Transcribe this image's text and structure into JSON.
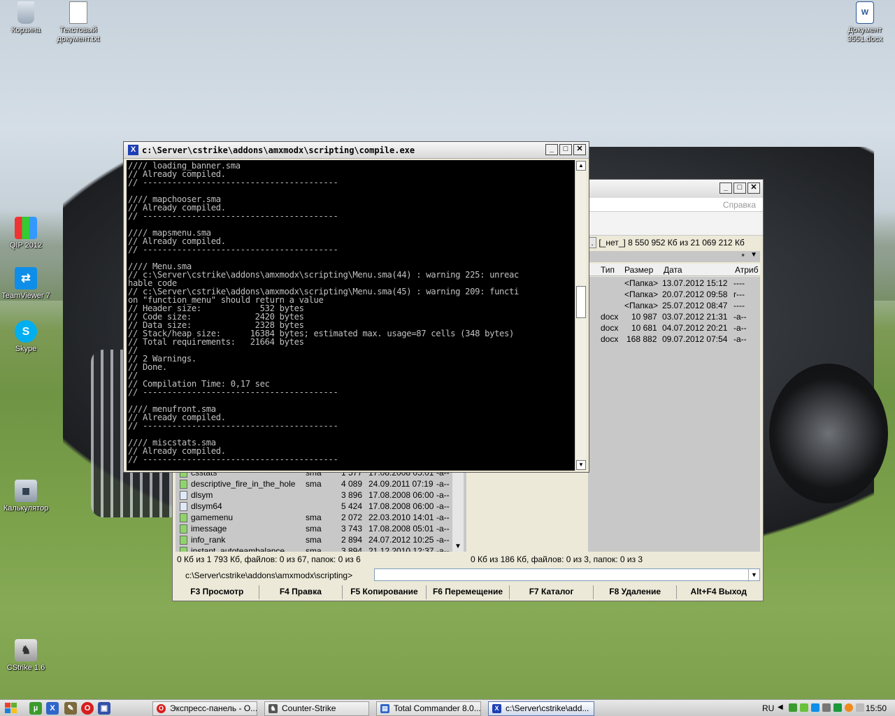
{
  "desktop_icons": [
    {
      "label": "Корзина",
      "icon": "recycle-bin-icon"
    },
    {
      "label": "Текстовый документ.txt",
      "icon": "text-document-icon"
    },
    {
      "label": "Документ 3551.docx",
      "icon": "word-document-icon"
    },
    {
      "label": "QIP 2012",
      "icon": "qip-icon"
    },
    {
      "label": "TeamViewer 7",
      "icon": "teamviewer-icon"
    },
    {
      "label": "Skype",
      "icon": "skype-icon"
    },
    {
      "label": "Калькулятор",
      "icon": "calculator-icon"
    },
    {
      "label": "CStrike 1.6",
      "icon": "counter-strike-icon"
    }
  ],
  "console": {
    "title": "c:\\Server\\cstrike\\addons\\amxmodx\\scripting\\compile.exe",
    "lines": [
      "//// loading_banner.sma",
      "// Already compiled.",
      "// ----------------------------------------",
      "",
      "//// mapchooser.sma",
      "// Already compiled.",
      "// ----------------------------------------",
      "",
      "//// mapsmenu.sma",
      "// Already compiled.",
      "// ----------------------------------------",
      "",
      "//// Menu.sma",
      "// c:\\Server\\cstrike\\addons\\amxmodx\\scripting\\Menu.sma(44) : warning 225: unreac",
      "hable code",
      "// c:\\Server\\cstrike\\addons\\amxmodx\\scripting\\Menu.sma(45) : warning 209: functi",
      "on \"function_menu\" should return a value",
      "// Header size:            532 bytes",
      "// Code size:             2420 bytes",
      "// Data size:             2328 bytes",
      "// Stack/heap size:      16384 bytes; estimated max. usage=87 cells (348 bytes)",
      "// Total requirements:   21664 bytes",
      "//",
      "// 2 Warnings.",
      "// Done.",
      "//",
      "// Compilation Time: 0,17 sec",
      "// ----------------------------------------",
      "",
      "//// menufront.sma",
      "// Already compiled.",
      "// ----------------------------------------",
      "",
      "//// miscstats.sma",
      "// Already compiled.",
      "// ----------------------------------------"
    ]
  },
  "tc": {
    "menu_help": "Справка",
    "right_drive": "[_нет_]  8 550 952 Кб из 21 069 212 Кб",
    "right_path_filter": "*",
    "right_columns": {
      "type": "Тип",
      "size": "Размер",
      "date": "Дата",
      "attr": "Атриб"
    },
    "right_rows": [
      {
        "type": "",
        "size": "<Папка>",
        "date": "13.07.2012 15:12",
        "attr": "----"
      },
      {
        "type": "",
        "size": "<Папка>",
        "date": "20.07.2012 09:58",
        "attr": "r---"
      },
      {
        "type": "",
        "size": "<Папка>",
        "date": "25.07.2012 08:47",
        "attr": "----"
      },
      {
        "type": "docx",
        "size": "10 987",
        "date": "03.07.2012 21:31",
        "attr": "-a--"
      },
      {
        "type": "docx",
        "size": "10 681",
        "date": "04.07.2012 20:21",
        "attr": "-a--"
      },
      {
        "type": "docx",
        "size": "168 882",
        "date": "09.07.2012 07:54",
        "attr": "-a--"
      }
    ],
    "left_rows": [
      {
        "name": "csstats",
        "ext": "sma",
        "size": "1 577",
        "date": "17.08.2008 05:01",
        "attr": "-a--",
        "kind": "sma"
      },
      {
        "name": "descriptive_fire_in_the_hole",
        "ext": "sma",
        "size": "4 089",
        "date": "24.09.2011 07:19",
        "attr": "-a--",
        "kind": "sma"
      },
      {
        "name": "dlsym",
        "ext": "",
        "size": "3 896",
        "date": "17.08.2008 06:00",
        "attr": "-a--",
        "kind": "bin"
      },
      {
        "name": "dlsym64",
        "ext": "",
        "size": "5 424",
        "date": "17.08.2008 06:00",
        "attr": "-a--",
        "kind": "bin"
      },
      {
        "name": "gamemenu",
        "ext": "sma",
        "size": "2 072",
        "date": "22.03.2010 14:01",
        "attr": "-a--",
        "kind": "sma"
      },
      {
        "name": "imessage",
        "ext": "sma",
        "size": "3 743",
        "date": "17.08.2008 05:01",
        "attr": "-a--",
        "kind": "sma"
      },
      {
        "name": "info_rank",
        "ext": "sma",
        "size": "2 894",
        "date": "24.07.2012 10:25",
        "attr": "-a--",
        "kind": "sma"
      },
      {
        "name": "instant_autoteambalance",
        "ext": "sma",
        "size": "3 894",
        "date": "21.12.2010 12:37",
        "attr": "-a--",
        "kind": "sma"
      }
    ],
    "left_status": "0 Кб из 1 793 Кб, файлов: 0 из 67, папок: 0 из 6",
    "right_status": "0 Кб из 186 Кб, файлов: 0 из 3, папок: 0 из 3",
    "cmd_path": "c:\\Server\\cstrike\\addons\\amxmodx\\scripting>",
    "fkeys": [
      "F3 Просмотр",
      "F4 Правка",
      "F5 Копирование",
      "F6 Перемещение",
      "F7 Каталог",
      "F8 Удаление",
      "Alt+F4 Выход"
    ]
  },
  "taskbar": {
    "buttons": [
      {
        "label": "Экспресс-панель - О...",
        "icon": "opera-icon"
      },
      {
        "label": "Counter-Strike",
        "icon": "counter-strike-icon"
      },
      {
        "label": "Total Commander 8.0...",
        "icon": "total-commander-icon"
      },
      {
        "label": "c:\\Server\\cstrike\\add...",
        "icon": "console-icon"
      }
    ],
    "lang": "RU",
    "clock": "15:50"
  }
}
